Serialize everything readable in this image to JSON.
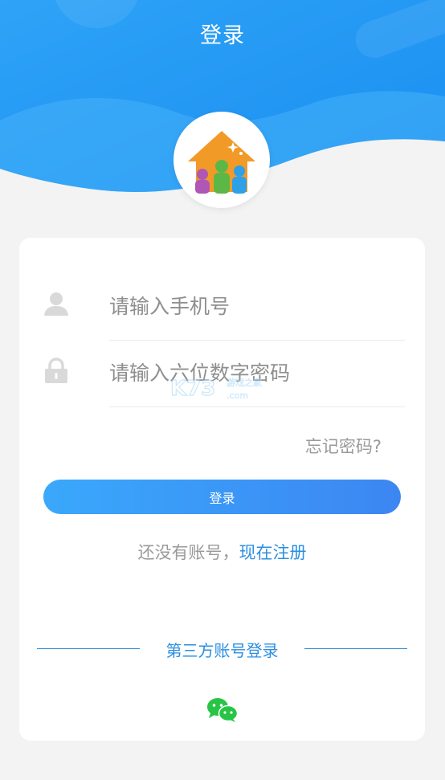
{
  "header": {
    "title": "登录"
  },
  "form": {
    "phone_placeholder": "请输入手机号",
    "password_placeholder": "请输入六位数字密码",
    "forgot_label": "忘记密码?",
    "login_label": "登录"
  },
  "register": {
    "prompt": "还没有账号，",
    "link": "现在注册"
  },
  "third_party": {
    "label": "第三方账号登录",
    "icons": [
      "wechat-icon"
    ]
  },
  "watermark": {
    "main": "K73",
    "sub": "游戏之家",
    "domain": ".com"
  },
  "colors": {
    "accent": "#2b8fe0",
    "button_start": "#3aa8fb",
    "button_end": "#3c86f2",
    "wechat": "#28c445"
  }
}
